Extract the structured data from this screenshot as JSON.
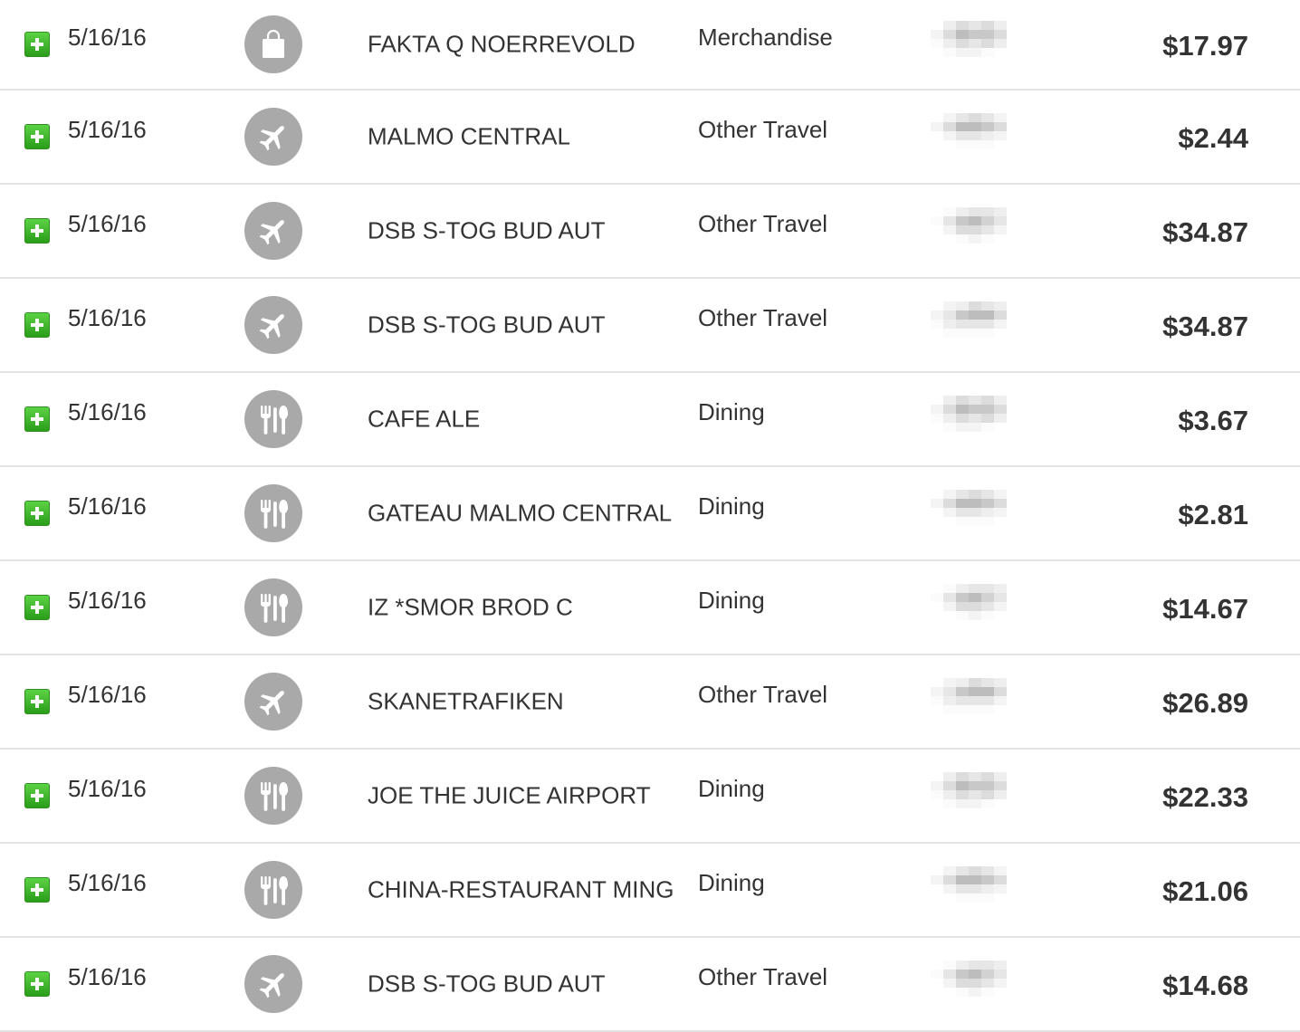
{
  "colors": {
    "text": "#333333",
    "icon_bg": "#a9a9a9",
    "add_button": "#3fb52a",
    "divider": "#e3e3e3"
  },
  "transactions": [
    {
      "date": "5/16/16",
      "icon": "shopping-bag-icon",
      "merchant": "FAKTA Q NOERREVOLD",
      "category": "Merchandise",
      "amount": "$17.97"
    },
    {
      "date": "5/16/16",
      "icon": "airplane-icon",
      "merchant": "MALMO CENTRAL",
      "category": "Other Travel",
      "amount": "$2.44"
    },
    {
      "date": "5/16/16",
      "icon": "airplane-icon",
      "merchant": "DSB S-TOG BUD AUT",
      "category": "Other Travel",
      "amount": "$34.87"
    },
    {
      "date": "5/16/16",
      "icon": "airplane-icon",
      "merchant": "DSB S-TOG BUD AUT",
      "category": "Other Travel",
      "amount": "$34.87"
    },
    {
      "date": "5/16/16",
      "icon": "fork-knife-icon",
      "merchant": "CAFE ALE",
      "category": "Dining",
      "amount": "$3.67"
    },
    {
      "date": "5/16/16",
      "icon": "fork-knife-icon",
      "merchant": "GATEAU MALMO CENTRAL",
      "category": "Dining",
      "amount": "$2.81"
    },
    {
      "date": "5/16/16",
      "icon": "fork-knife-icon",
      "merchant": "IZ *SMOR BROD C",
      "category": "Dining",
      "amount": "$14.67"
    },
    {
      "date": "5/16/16",
      "icon": "airplane-icon",
      "merchant": "SKANETRAFIKEN",
      "category": "Other Travel",
      "amount": "$26.89"
    },
    {
      "date": "5/16/16",
      "icon": "fork-knife-icon",
      "merchant": "JOE THE JUICE AIRPORT",
      "category": "Dining",
      "amount": "$22.33"
    },
    {
      "date": "5/16/16",
      "icon": "fork-knife-icon",
      "merchant": "CHINA-RESTAURANT MING",
      "category": "Dining",
      "amount": "$21.06"
    },
    {
      "date": "5/16/16",
      "icon": "airplane-icon",
      "merchant": "DSB S-TOG BUD AUT",
      "category": "Other Travel",
      "amount": "$14.68"
    }
  ]
}
